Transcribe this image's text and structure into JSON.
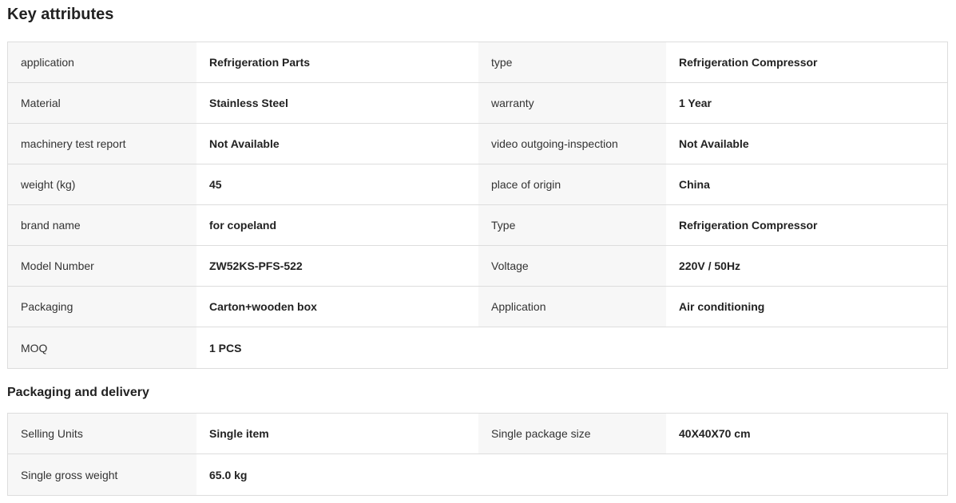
{
  "key_attributes": {
    "title": "Key attributes",
    "rows": [
      [
        {
          "label": "application",
          "value": "Refrigeration Parts"
        },
        {
          "label": "type",
          "value": "Refrigeration Compressor"
        }
      ],
      [
        {
          "label": "Material",
          "value": "Stainless Steel"
        },
        {
          "label": "warranty",
          "value": "1 Year"
        }
      ],
      [
        {
          "label": "machinery test report",
          "value": "Not Available"
        },
        {
          "label": "video outgoing-inspection",
          "value": "Not Available"
        }
      ],
      [
        {
          "label": "weight (kg)",
          "value": "45"
        },
        {
          "label": "place of origin",
          "value": "China"
        }
      ],
      [
        {
          "label": "brand name",
          "value": "for copeland"
        },
        {
          "label": "Type",
          "value": "Refrigeration Compressor"
        }
      ],
      [
        {
          "label": "Model Number",
          "value": "ZW52KS-PFS-522"
        },
        {
          "label": "Voltage",
          "value": "220V / 50Hz"
        }
      ],
      [
        {
          "label": "Packaging",
          "value": "Carton+wooden box"
        },
        {
          "label": "Application",
          "value": "Air conditioning"
        }
      ],
      [
        {
          "label": "MOQ",
          "value": "1 PCS"
        }
      ]
    ]
  },
  "packaging_delivery": {
    "title": "Packaging and delivery",
    "rows": [
      [
        {
          "label": "Selling Units",
          "value": "Single item"
        },
        {
          "label": "Single package size",
          "value": "40X40X70 cm"
        }
      ],
      [
        {
          "label": "Single gross weight",
          "value": "65.0 kg"
        }
      ]
    ]
  }
}
